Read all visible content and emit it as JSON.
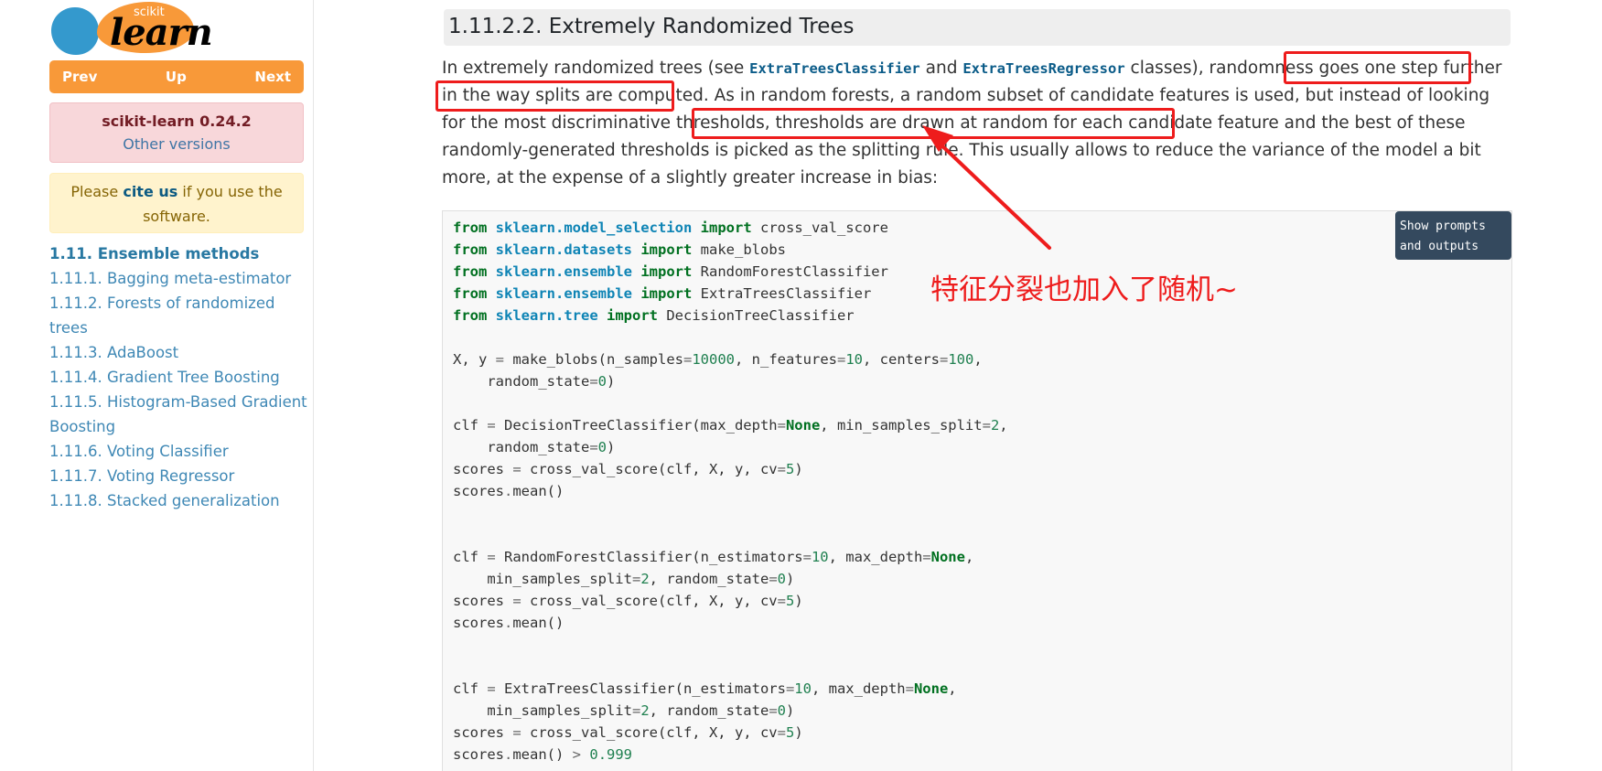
{
  "sidebar": {
    "logo": {
      "top": "scikit",
      "main": "learn"
    },
    "nav": {
      "prev": "Prev",
      "up": "Up",
      "next": "Next"
    },
    "version": {
      "label": "scikit-learn 0.24.2",
      "other": "Other versions"
    },
    "cite": {
      "before": "Please ",
      "link": "cite us",
      "after": " if you use the software."
    },
    "toc": {
      "heading": "1.11. Ensemble methods",
      "items": [
        "1.11.1. Bagging meta-estimator",
        "1.11.2. Forests of randomized trees",
        "1.11.3. AdaBoost",
        "1.11.4. Gradient Tree Boosting",
        "1.11.5. Histogram-Based Gradient Boosting",
        "1.11.6. Voting Classifier",
        "1.11.7. Voting Regressor",
        "1.11.8. Stacked generalization"
      ]
    }
  },
  "main": {
    "section_title": "1.11.2.2. Extremely Randomized Trees",
    "para": {
      "p1": "In extremely randomized trees (see ",
      "code1": "ExtraTreesClassifier",
      "p2": " and ",
      "code2": "ExtraTreesRegressor",
      "p3": " classes), randomness goes one step further in the way splits are computed. As in random forests, a random subset of candidate features is used, but instead of looking for the most discriminative thresholds, thresholds are drawn at random for each candidate feature and the best of these randomly-generated thresholds is picked as the splitting rule. This usually allows to reduce the variance of the model a bit more, at the expense of a slightly greater increase in bias:"
    },
    "show_prompts": "Show prompts and outputs",
    "annotation": "特征分裂也加入了随机~",
    "colors": {
      "annotation_red": "#ee1c1c",
      "sidebar_orange": "#f89939",
      "logo_blue": "#3499cd"
    }
  }
}
